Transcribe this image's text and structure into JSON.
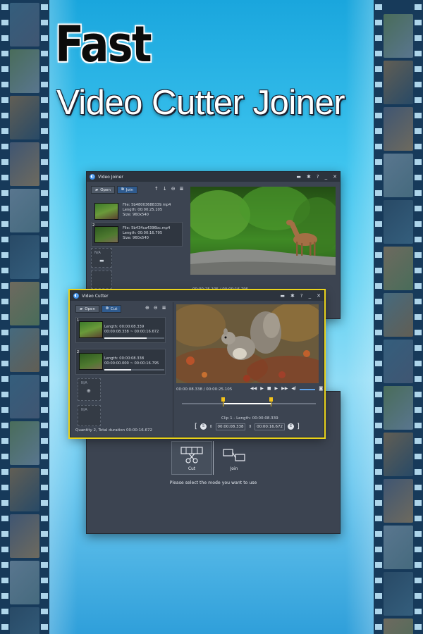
{
  "title_line1": "Fast",
  "title_line2": "Video Cutter Joiner",
  "joiner": {
    "title": "Video Joiner",
    "toolbar": {
      "open": "Open",
      "join": "Join"
    },
    "items": [
      {
        "index": "",
        "file": "File: 5b48003688339.mp4",
        "length": "Length: 00:00:25.105",
        "size": "Size: 960x540"
      },
      {
        "index": "2",
        "file": "File: 5b434ca4396bc.mp4",
        "length": "Length: 00:00:16.795",
        "size": "Size: 960x540"
      }
    ],
    "empty_label": "N/A",
    "time_readout": "00:00:25.105 / 00:00:16.795"
  },
  "cutter": {
    "title": "Video Cutter",
    "toolbar": {
      "open": "Open",
      "cut": "Cut"
    },
    "items": [
      {
        "index": "1",
        "length": "Length: 00:00:08.339",
        "range": "00:00:08.338 ~ 00:00:16.672",
        "progress": 0.7
      },
      {
        "index": "2",
        "length": "Length: 00:00:08.338",
        "range": "00:00:00.000 ~ 00:00:16.795",
        "progress": 0.45
      }
    ],
    "empty_label": "N/A",
    "quantity": "Quantity 2, Total duration 00:00:16.672",
    "time_readout": "00:00:08.338 / 00:00:25.105",
    "clip_info": "Clip 1 - Length: 00:00:08.339",
    "start_time": "00:00:08.338",
    "end_time": "00:00:16.672",
    "start_marker": "S",
    "end_marker": "E"
  },
  "main": {
    "cut_label": "Cut",
    "join_label": "Join",
    "prompt": "Please select the mode you want to use"
  },
  "colors": {
    "highlight": "#e9d31c",
    "accent": "#2f5b8f"
  }
}
